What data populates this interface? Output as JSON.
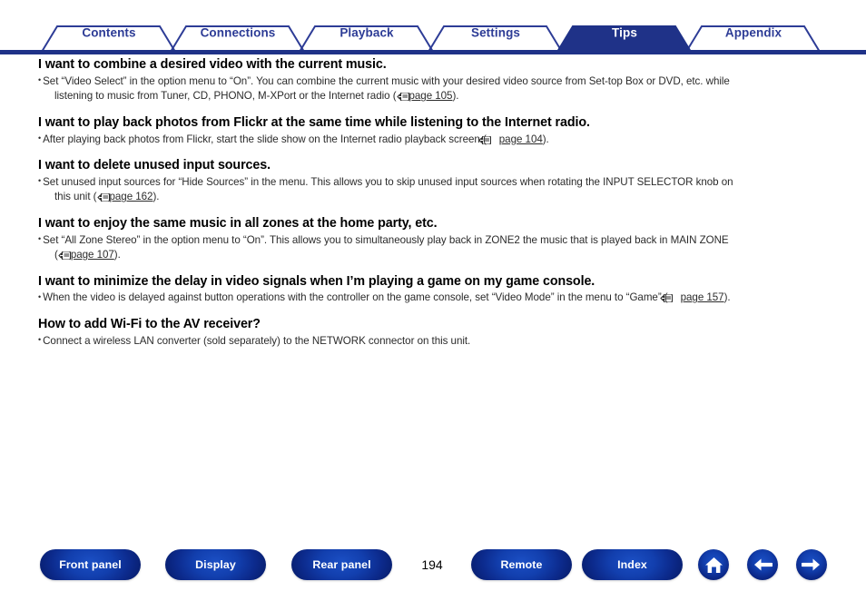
{
  "tabs": [
    {
      "label": "Contents",
      "active": false
    },
    {
      "label": "Connections",
      "active": false
    },
    {
      "label": "Playback",
      "active": false
    },
    {
      "label": "Settings",
      "active": false
    },
    {
      "label": "Tips",
      "active": true
    },
    {
      "label": "Appendix",
      "active": false
    }
  ],
  "colors": {
    "tab_stroke": "#2d3c96",
    "tab_text": "#2d3c96",
    "tab_active_bg": "#1f3288",
    "tab_active_text": "#ffffff",
    "button_blue": "#123fae",
    "body_text": "#2b2b2b"
  },
  "sections": [
    {
      "heading": "I want to combine a desired video with the current music.",
      "line1": "Set “Video Select” in the option menu to “On”. You can combine the current music with your desired video source from Set-top Box or DVD, etc. while",
      "line2_pre": "listening to music from Tuner, CD, PHONO, M-XPort or the Internet radio (",
      "pageref": "page 105",
      "line2_post": ")."
    },
    {
      "heading": "I want to play back photos from Flickr at the same time while listening to the Internet radio.",
      "line1": "After playing back photos from Flickr, start the slide show on the Internet radio playback screen (",
      "line2_pre": "",
      "pageref": "page 104",
      "line2_post": ")."
    },
    {
      "heading": "I want to delete unused input sources.",
      "line1": "Set unused input sources for “Hide Sources” in the menu. This allows you to skip unused input sources when rotating the INPUT SELECTOR knob on",
      "line2_pre": "this unit (",
      "pageref": "page 162",
      "line2_post": ")."
    },
    {
      "heading": "I want to enjoy the same music in all zones at the home party, etc.",
      "line1": "Set “All Zone Stereo” in the option menu to “On”. This allows you to simultaneously play back in ZONE2 the music that is played back in MAIN ZONE",
      "line2_pre": "(",
      "pageref": "page 107",
      "line2_post": ")."
    },
    {
      "heading": "I want to minimize the delay in video signals when I’m playing a game on my game console.",
      "line1": "When the video is delayed against button operations with the controller on the game console, set “Video Mode” in the menu to “Game” (",
      "line2_pre": "",
      "pageref": "page 157",
      "line2_post": ")."
    },
    {
      "heading": "How to add Wi-Fi to the AV receiver?",
      "line1": "Connect a wireless LAN converter (sold separately) to the NETWORK connector on this unit.",
      "line2_pre": "",
      "pageref": "",
      "line2_post": ""
    }
  ],
  "bullet": "•",
  "footer": {
    "buttons": [
      {
        "label": "Front panel",
        "icon": ""
      },
      {
        "label": "Display",
        "icon": ""
      },
      {
        "label": "Rear panel",
        "icon": ""
      },
      {
        "label": "Remote",
        "icon": ""
      },
      {
        "label": "Index",
        "icon": ""
      }
    ],
    "page_number": "194",
    "home_icon": "home-icon",
    "back_icon": "arrow-left-icon",
    "forward_icon": "arrow-right-icon"
  }
}
